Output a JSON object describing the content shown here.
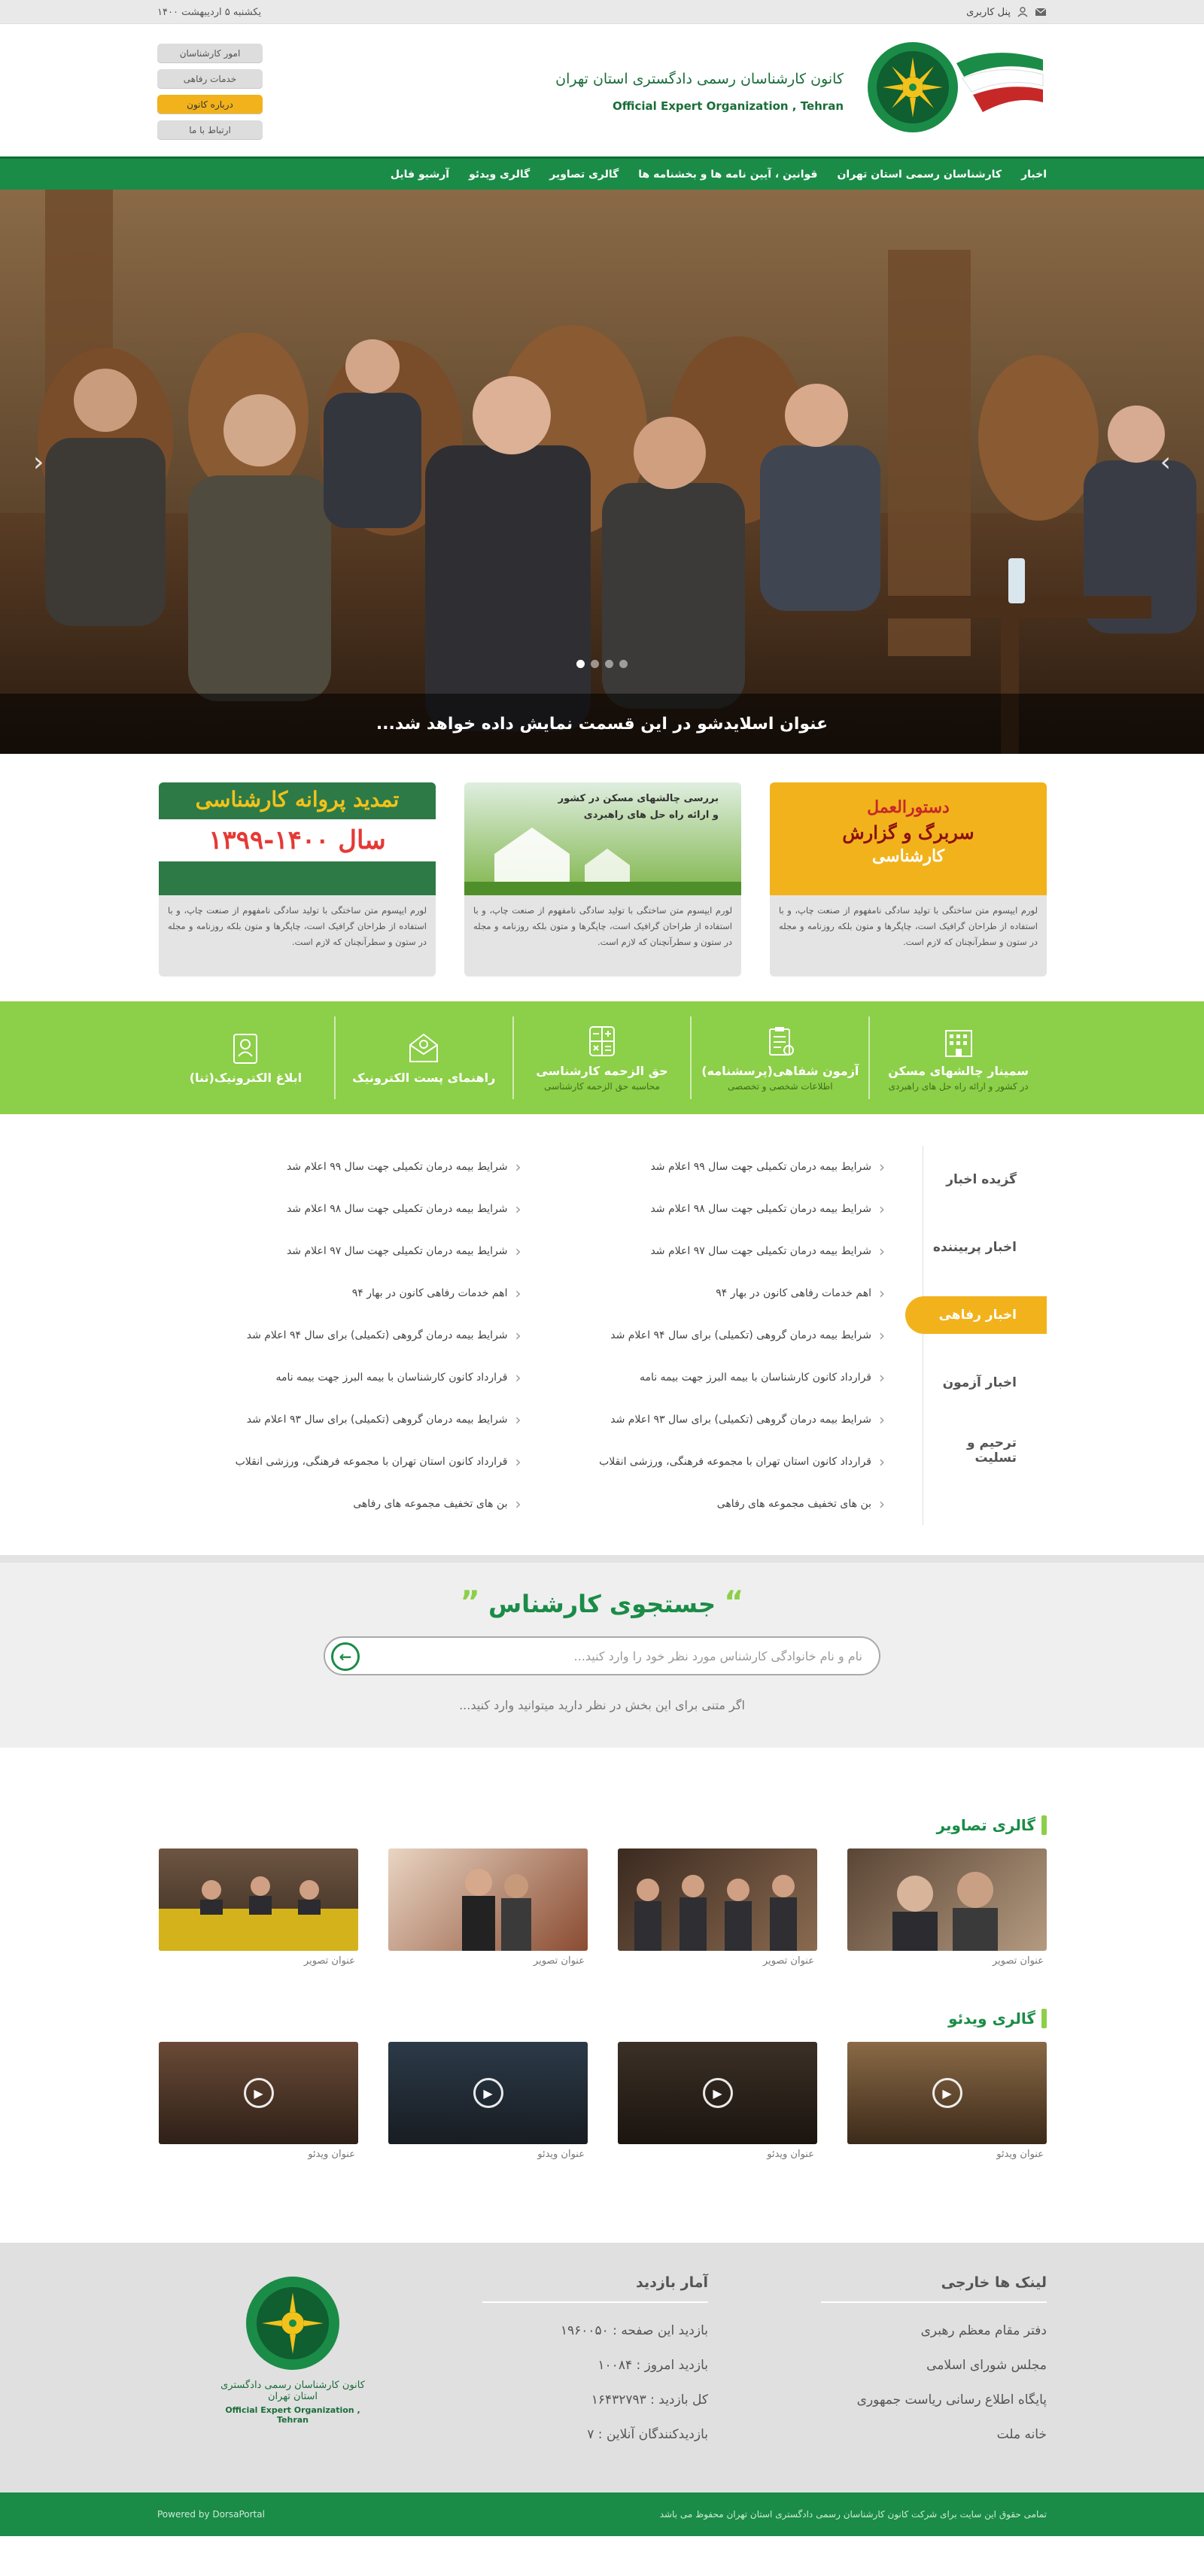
{
  "topbar": {
    "panel_label": "پنل کاربری",
    "date": "یکشنبه ۵ اردیبهشت ۱۴۰۰"
  },
  "header": {
    "logo_title_fa": "کانون کارشناسان رسمی دادگستری استان تهران",
    "logo_title_en": "Official Expert Organization , Tehran",
    "side_links": [
      "امور کارشناسان",
      "خدمات رفاهی",
      "درباره کانون",
      "ارتباط با ما"
    ],
    "side_active_index": 2
  },
  "nav": [
    "اخبار",
    "کارشناسان رسمی استان تهران",
    "قوانین ، آیین نامه ها و بخشنامه ها",
    "گالری تصاویر",
    "گالری ویدئو",
    "آرشیو فایل"
  ],
  "slider": {
    "caption": "عنوان اسلایدشو در این قسمت نمایش داده خواهد شد...",
    "dots": 4,
    "active_dot": 0
  },
  "cards": [
    {
      "banner": [
        "دستورالعمل",
        "سربرگ و گزارش",
        "کارشناسی"
      ],
      "text": "لورم ایپسوم متن ساختگی با تولید سادگی نامفهوم از صنعت چاپ، و با استفاده از طراحان گرافیک است، چاپگرها و متون بلکه روزنامه و مجله در ستون و سطرآنچنان که لازم است."
    },
    {
      "banner": [
        "بررسی چالشهای مسکن در کشور",
        "و ارائه راه حل های راهبردی"
      ],
      "text": "لورم ایپسوم متن ساختگی با تولید سادگی نامفهوم از صنعت چاپ، و با استفاده از طراحان گرافیک است، چاپگرها و متون بلکه روزنامه و مجله در ستون و سطرآنچنان که لازم است."
    },
    {
      "banner": [
        "تمدید پروانه کارشناسی",
        "سال ۱۴۰۰-۱۳۹۹"
      ],
      "text": "لورم ایپسوم متن ساختگی با تولید سادگی نامفهوم از صنعت چاپ، و با استفاده از طراحان گرافیک است، چاپگرها و متون بلکه روزنامه و مجله در ستون و سطرآنچنان که لازم است."
    }
  ],
  "services": [
    {
      "title": "سمینار چالشهای مسکن",
      "sub": "در کشور و ارائه راه حل های راهبردی",
      "icon": "building-icon"
    },
    {
      "title": "آزمون شفاهی(پرسشنامه)",
      "sub": "اطلاعات شخصی و تخصصی",
      "icon": "clipboard-icon"
    },
    {
      "title": "حق الزحمه کارشناسی",
      "sub": "محاسبه حق الزحمه کارشناسی",
      "icon": "calculator-icon"
    },
    {
      "title": "راهنمای پست الکترونیک",
      "sub": "",
      "icon": "mail-icon"
    },
    {
      "title": "ابلاغ الکترونیک(ثنا)",
      "sub": "",
      "icon": "id-card-icon"
    }
  ],
  "news": {
    "tabs": [
      "گزیده اخبار",
      "اخبار پربیننده",
      "اخبار رفاهی",
      "اخبار آزمون",
      "ترحیم و تسلیت"
    ],
    "active_tab": 2,
    "col_right": [
      "شرایط بیمه درمان تکمیلی جهت سال ۹۹ اعلام شد",
      "شرایط بیمه درمان تکمیلی جهت سال ۹۸ اعلام شد",
      "شرایط بیمه درمان تکمیلی جهت سال ۹۷ اعلام شد",
      "اهم خدمات رفاهی کانون در بهار ۹۴",
      "شرایط بیمه درمان گروهی (تکمیلی) برای سال ۹۴ اعلام شد",
      "قرارداد کانون کارشناسان با بیمه البرز جهت بیمه نامه",
      "شرایط بیمه درمان گروهی (تکمیلی) برای سال ۹۳ اعلام شد",
      "قرارداد کانون استان تهران با مجموعه فرهنگی، ورزشی انقلاب",
      "بن های تخفیف مجموعه های رفاهی"
    ],
    "col_left": [
      "شرایط بیمه درمان تکمیلی جهت سال ۹۹ اعلام شد",
      "شرایط بیمه درمان تکمیلی جهت سال ۹۸ اعلام شد",
      "شرایط بیمه درمان تکمیلی جهت سال ۹۷ اعلام شد",
      "اهم خدمات رفاهی کانون در بهار ۹۴",
      "شرایط بیمه درمان گروهی (تکمیلی) برای سال ۹۴ اعلام شد",
      "قرارداد کانون کارشناسان با بیمه البرز جهت بیمه نامه",
      "شرایط بیمه درمان گروهی (تکمیلی) برای سال ۹۳ اعلام شد",
      "قرارداد کانون استان تهران با مجموعه فرهنگی، ورزشی انقلاب",
      "بن های تخفیف مجموعه های رفاهی"
    ]
  },
  "search": {
    "title": "جستجوی کارشناس",
    "placeholder": "نام و نام خانوادگی کارشناس مورد نظر خود را وارد کنید...",
    "hint": "اگر متنی برای این بخش در نظر دارید میتوانید وارد کنید..."
  },
  "gallery_images": {
    "title": "گالری تصاویر",
    "items": [
      "عنوان تصویر",
      "عنوان تصویر",
      "عنوان تصویر",
      "عنوان تصویر"
    ]
  },
  "gallery_videos": {
    "title": "گالری ویدئو",
    "items": [
      "عنوان ویدئو",
      "عنوان ویدئو",
      "عنوان ویدئو",
      "عنوان ویدئو"
    ]
  },
  "footer": {
    "links_title": "لینک ها خارجی",
    "links": [
      "دفتر مقام معظم رهبری",
      "مجلس شورای اسلامی",
      "پایگاه اطلاع رسانی ریاست جمهوری",
      "خانه ملت"
    ],
    "stats_title": "آمار بازدید",
    "stats": [
      "بازدید این صفحه : ۱۹۶۰۰۵۰",
      "بازدید امروز : ۱۰۰۸۴",
      "کل بازدید : ۱۶۴۳۲۷۹۳",
      "بازدیدکنندگان آنلاین : ۷"
    ],
    "copyright": "تمامی حقوق این سایت برای شرکت کانون کارشناسان رسمی دادگستری استان تهران محفوظ می باشد",
    "powered": "Powered by DorsaPortal"
  },
  "colors": {
    "green": "#1a8c47",
    "light_green": "#8ccf48",
    "yellow": "#f2b21b"
  }
}
